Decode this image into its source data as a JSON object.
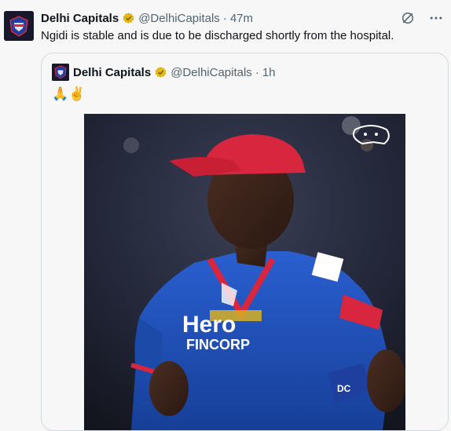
{
  "tweet": {
    "author_name": "Delhi Capitals",
    "handle": "@DelhiCapitals",
    "separator": "·",
    "time": "47m",
    "text": "Ngidi is stable and is due to be discharged shortly from the hospital.",
    "avatar_icon": "delhi-capitals-logo",
    "verified_icon": "gold-verified-badge",
    "verified_color": "#e2b719",
    "actions": [
      "grok-icon",
      "more-options-icon"
    ]
  },
  "quoted_tweet": {
    "author_name": "Delhi Capitals",
    "handle": "@DelhiCapitals",
    "separator": "·",
    "time": "1h",
    "text": "🙏✌️",
    "avatar_icon": "delhi-capitals-logo",
    "verified_icon": "gold-verified-badge",
    "media": {
      "kind": "photo",
      "jersey_sponsor": "Hero",
      "jersey_sponsor_sub": "FINCORP",
      "sleeve_text": "DC",
      "jersey_color": "#1f4fb8",
      "cap_color": "#d7263d"
    }
  }
}
